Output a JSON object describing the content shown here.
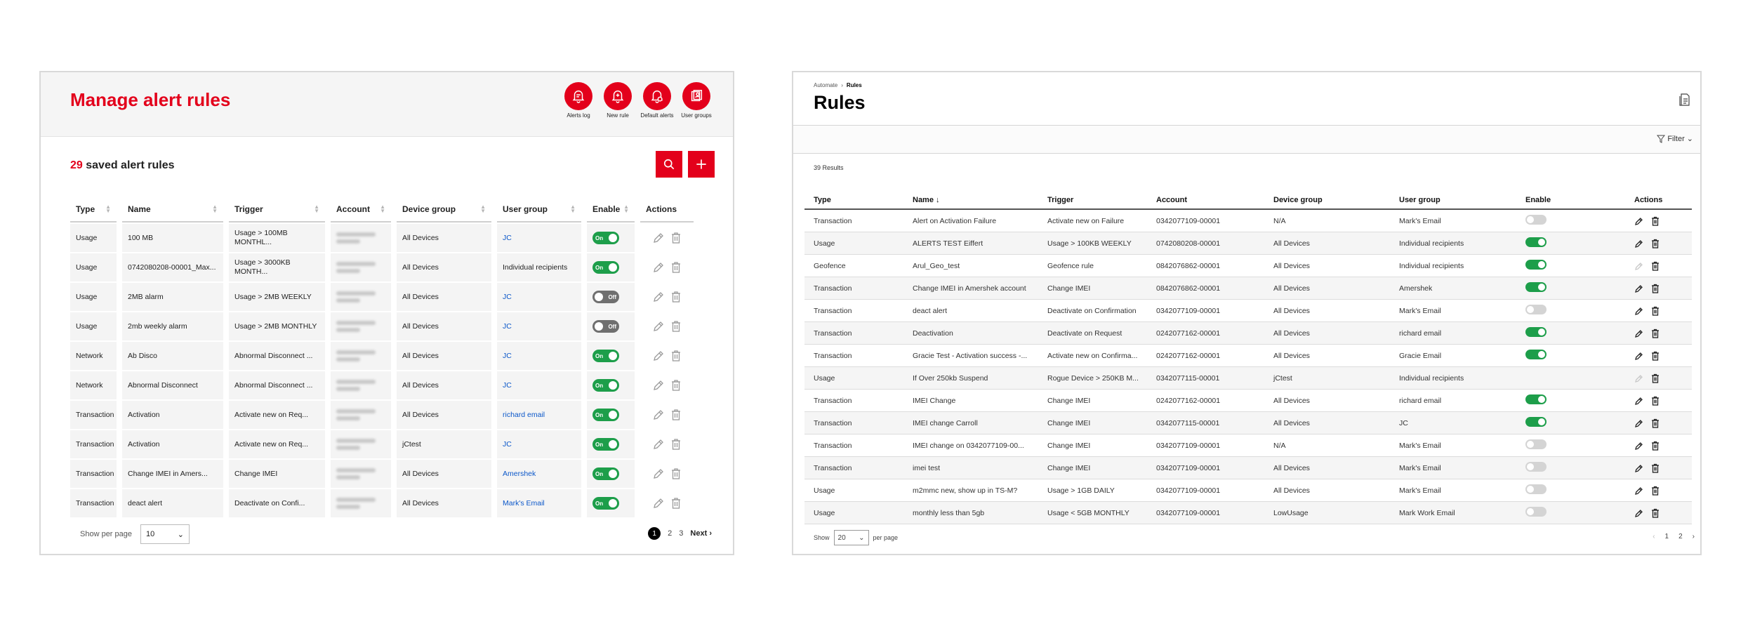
{
  "left": {
    "title": "Manage alert rules",
    "header_actions": [
      {
        "label": "Alerts log",
        "icon": "alerts-log-icon"
      },
      {
        "label": "New rule",
        "icon": "bell-plus-icon"
      },
      {
        "label": "Default alerts",
        "icon": "bell-settings-icon"
      },
      {
        "label": "User groups",
        "icon": "user-groups-icon"
      }
    ],
    "count": "29",
    "count_label": " saved alert rules",
    "columns": [
      "Type",
      "Name",
      "Trigger",
      "Account",
      "Device group",
      "User group",
      "Enable",
      "Actions"
    ],
    "rows": [
      {
        "type": "Usage",
        "name": "100 MB",
        "trigger": "Usage > 100MB MONTHL...",
        "device_group": "All Devices",
        "user_group": "JC",
        "user_group_link": true,
        "enable": "On"
      },
      {
        "type": "Usage",
        "name": "0742080208-00001_Max...",
        "trigger": "Usage > 3000KB MONTH...",
        "device_group": "All Devices",
        "user_group": "Individual recipients",
        "user_group_link": false,
        "enable": "On"
      },
      {
        "type": "Usage",
        "name": "2MB alarm",
        "trigger": "Usage > 2MB WEEKLY",
        "device_group": "All Devices",
        "user_group": "JC",
        "user_group_link": true,
        "enable": "Off"
      },
      {
        "type": "Usage",
        "name": "2mb weekly alarm",
        "trigger": "Usage > 2MB MONTHLY",
        "device_group": "All Devices",
        "user_group": "JC",
        "user_group_link": true,
        "enable": "Off"
      },
      {
        "type": "Network",
        "name": "Ab Disco",
        "trigger": "Abnormal Disconnect ...",
        "device_group": "All Devices",
        "user_group": "JC",
        "user_group_link": true,
        "enable": "On"
      },
      {
        "type": "Network",
        "name": "Abnormal Disconnect",
        "trigger": "Abnormal Disconnect ...",
        "device_group": "All Devices",
        "user_group": "JC",
        "user_group_link": true,
        "enable": "On"
      },
      {
        "type": "Transaction",
        "name": "Activation",
        "trigger": "Activate new on Req...",
        "device_group": "All Devices",
        "user_group": "richard email",
        "user_group_link": true,
        "enable": "On"
      },
      {
        "type": "Transaction",
        "name": "Activation",
        "trigger": "Activate new on Req...",
        "device_group": "jCtest",
        "user_group": "JC",
        "user_group_link": true,
        "enable": "On"
      },
      {
        "type": "Transaction",
        "name": "Change IMEI in Amers...",
        "trigger": "Change IMEI",
        "device_group": "All Devices",
        "user_group": "Amershek",
        "user_group_link": true,
        "enable": "On"
      },
      {
        "type": "Transaction",
        "name": "deact alert",
        "trigger": "Deactivate on Confi...",
        "device_group": "All Devices",
        "user_group": "Mark's Email",
        "user_group_link": true,
        "enable": "On"
      }
    ],
    "footer": {
      "show_per_page_label": "Show per page",
      "per_page_value": "10",
      "pages": [
        "1",
        "2",
        "3"
      ],
      "current_page": "1",
      "next_label": "Next"
    }
  },
  "right": {
    "breadcrumb": [
      "Automate",
      "Rules"
    ],
    "title": "Rules",
    "filter_label": "Filter",
    "results_count": "39 Results",
    "columns": [
      "Type",
      "Name",
      "Trigger",
      "Account",
      "Device group",
      "User group",
      "Enable",
      "Actions"
    ],
    "name_sort_indicator": "↓",
    "rows": [
      {
        "type": "Transaction",
        "name": "Alert on Activation Failure",
        "trigger": "Activate new on Failure",
        "account": "0342077109-00001",
        "device_group": "N/A",
        "user_group": "Mark's Email",
        "enable": "off",
        "actions_enabled": true
      },
      {
        "type": "Usage",
        "name": "ALERTS TEST Eiffert",
        "trigger": "Usage > 100KB WEEKLY",
        "account": "0742080208-00001",
        "device_group": "All Devices",
        "user_group": "Individual recipients",
        "enable": "on",
        "actions_enabled": true
      },
      {
        "type": "Geofence",
        "name": "Arul_Geo_test",
        "trigger": "Geofence rule",
        "account": "0842076862-00001",
        "device_group": "All Devices",
        "user_group": "Individual recipients",
        "enable": "on",
        "actions_enabled": false
      },
      {
        "type": "Transaction",
        "name": "Change IMEI in Amershek account",
        "trigger": "Change IMEI",
        "account": "0842076862-00001",
        "device_group": "All Devices",
        "user_group": "Amershek",
        "enable": "on",
        "actions_enabled": true
      },
      {
        "type": "Transaction",
        "name": "deact alert",
        "trigger": "Deactivate on Confirmation",
        "account": "0342077109-00001",
        "device_group": "All Devices",
        "user_group": "Mark's Email",
        "enable": "off",
        "actions_enabled": true
      },
      {
        "type": "Transaction",
        "name": "Deactivation",
        "trigger": "Deactivate on Request",
        "account": "0242077162-00001",
        "device_group": "All Devices",
        "user_group": "richard email",
        "enable": "on",
        "actions_enabled": true
      },
      {
        "type": "Transaction",
        "name": "Gracie Test - Activation success -...",
        "trigger": "Activate new on Confirma...",
        "account": "0242077162-00001",
        "device_group": "All Devices",
        "user_group": "Gracie Email",
        "enable": "on",
        "actions_enabled": true
      },
      {
        "type": "Usage",
        "name": "If Over 250kb Suspend",
        "trigger": "Rogue Device > 250KB M...",
        "account": "0342077115-00001",
        "device_group": "jCtest",
        "user_group": "Individual recipients",
        "enable": "none",
        "actions_enabled": false
      },
      {
        "type": "Transaction",
        "name": "IMEI Change",
        "trigger": "Change IMEI",
        "account": "0242077162-00001",
        "device_group": "All Devices",
        "user_group": "richard email",
        "enable": "on",
        "actions_enabled": true
      },
      {
        "type": "Transaction",
        "name": "IMEI change Carroll",
        "trigger": "Change IMEI",
        "account": "0342077115-00001",
        "device_group": "All Devices",
        "user_group": "JC",
        "enable": "on",
        "actions_enabled": true
      },
      {
        "type": "Transaction",
        "name": "IMEI change on 0342077109-00...",
        "trigger": "Change IMEI",
        "account": "0342077109-00001",
        "device_group": "N/A",
        "user_group": "Mark's Email",
        "enable": "off",
        "actions_enabled": true
      },
      {
        "type": "Transaction",
        "name": "imei test",
        "trigger": "Change IMEI",
        "account": "0342077109-00001",
        "device_group": "All Devices",
        "user_group": "Mark's Email",
        "enable": "off",
        "actions_enabled": true
      },
      {
        "type": "Usage",
        "name": "m2mmc new, show up in TS-M?",
        "trigger": "Usage > 1GB DAILY",
        "account": "0342077109-00001",
        "device_group": "All Devices",
        "user_group": "Mark's Email",
        "enable": "off",
        "actions_enabled": true
      },
      {
        "type": "Usage",
        "name": "monthly less than 5gb",
        "trigger": "Usage < 5GB MONTHLY",
        "account": "0342077109-00001",
        "device_group": "LowUsage",
        "user_group": "Mark Work Email",
        "enable": "off",
        "actions_enabled": true
      }
    ],
    "footer": {
      "show_label": "Show",
      "per_page_value": "20",
      "per_page_label": "per page",
      "pages": [
        "1",
        "2"
      ]
    }
  },
  "colors": {
    "brand_red": "#e3001b",
    "toggle_on": "#1d9e4a",
    "toggle_off_left": "#6f6f6f",
    "toggle_off_right": "#d4d4d4",
    "link_blue": "#0b57c9"
  }
}
